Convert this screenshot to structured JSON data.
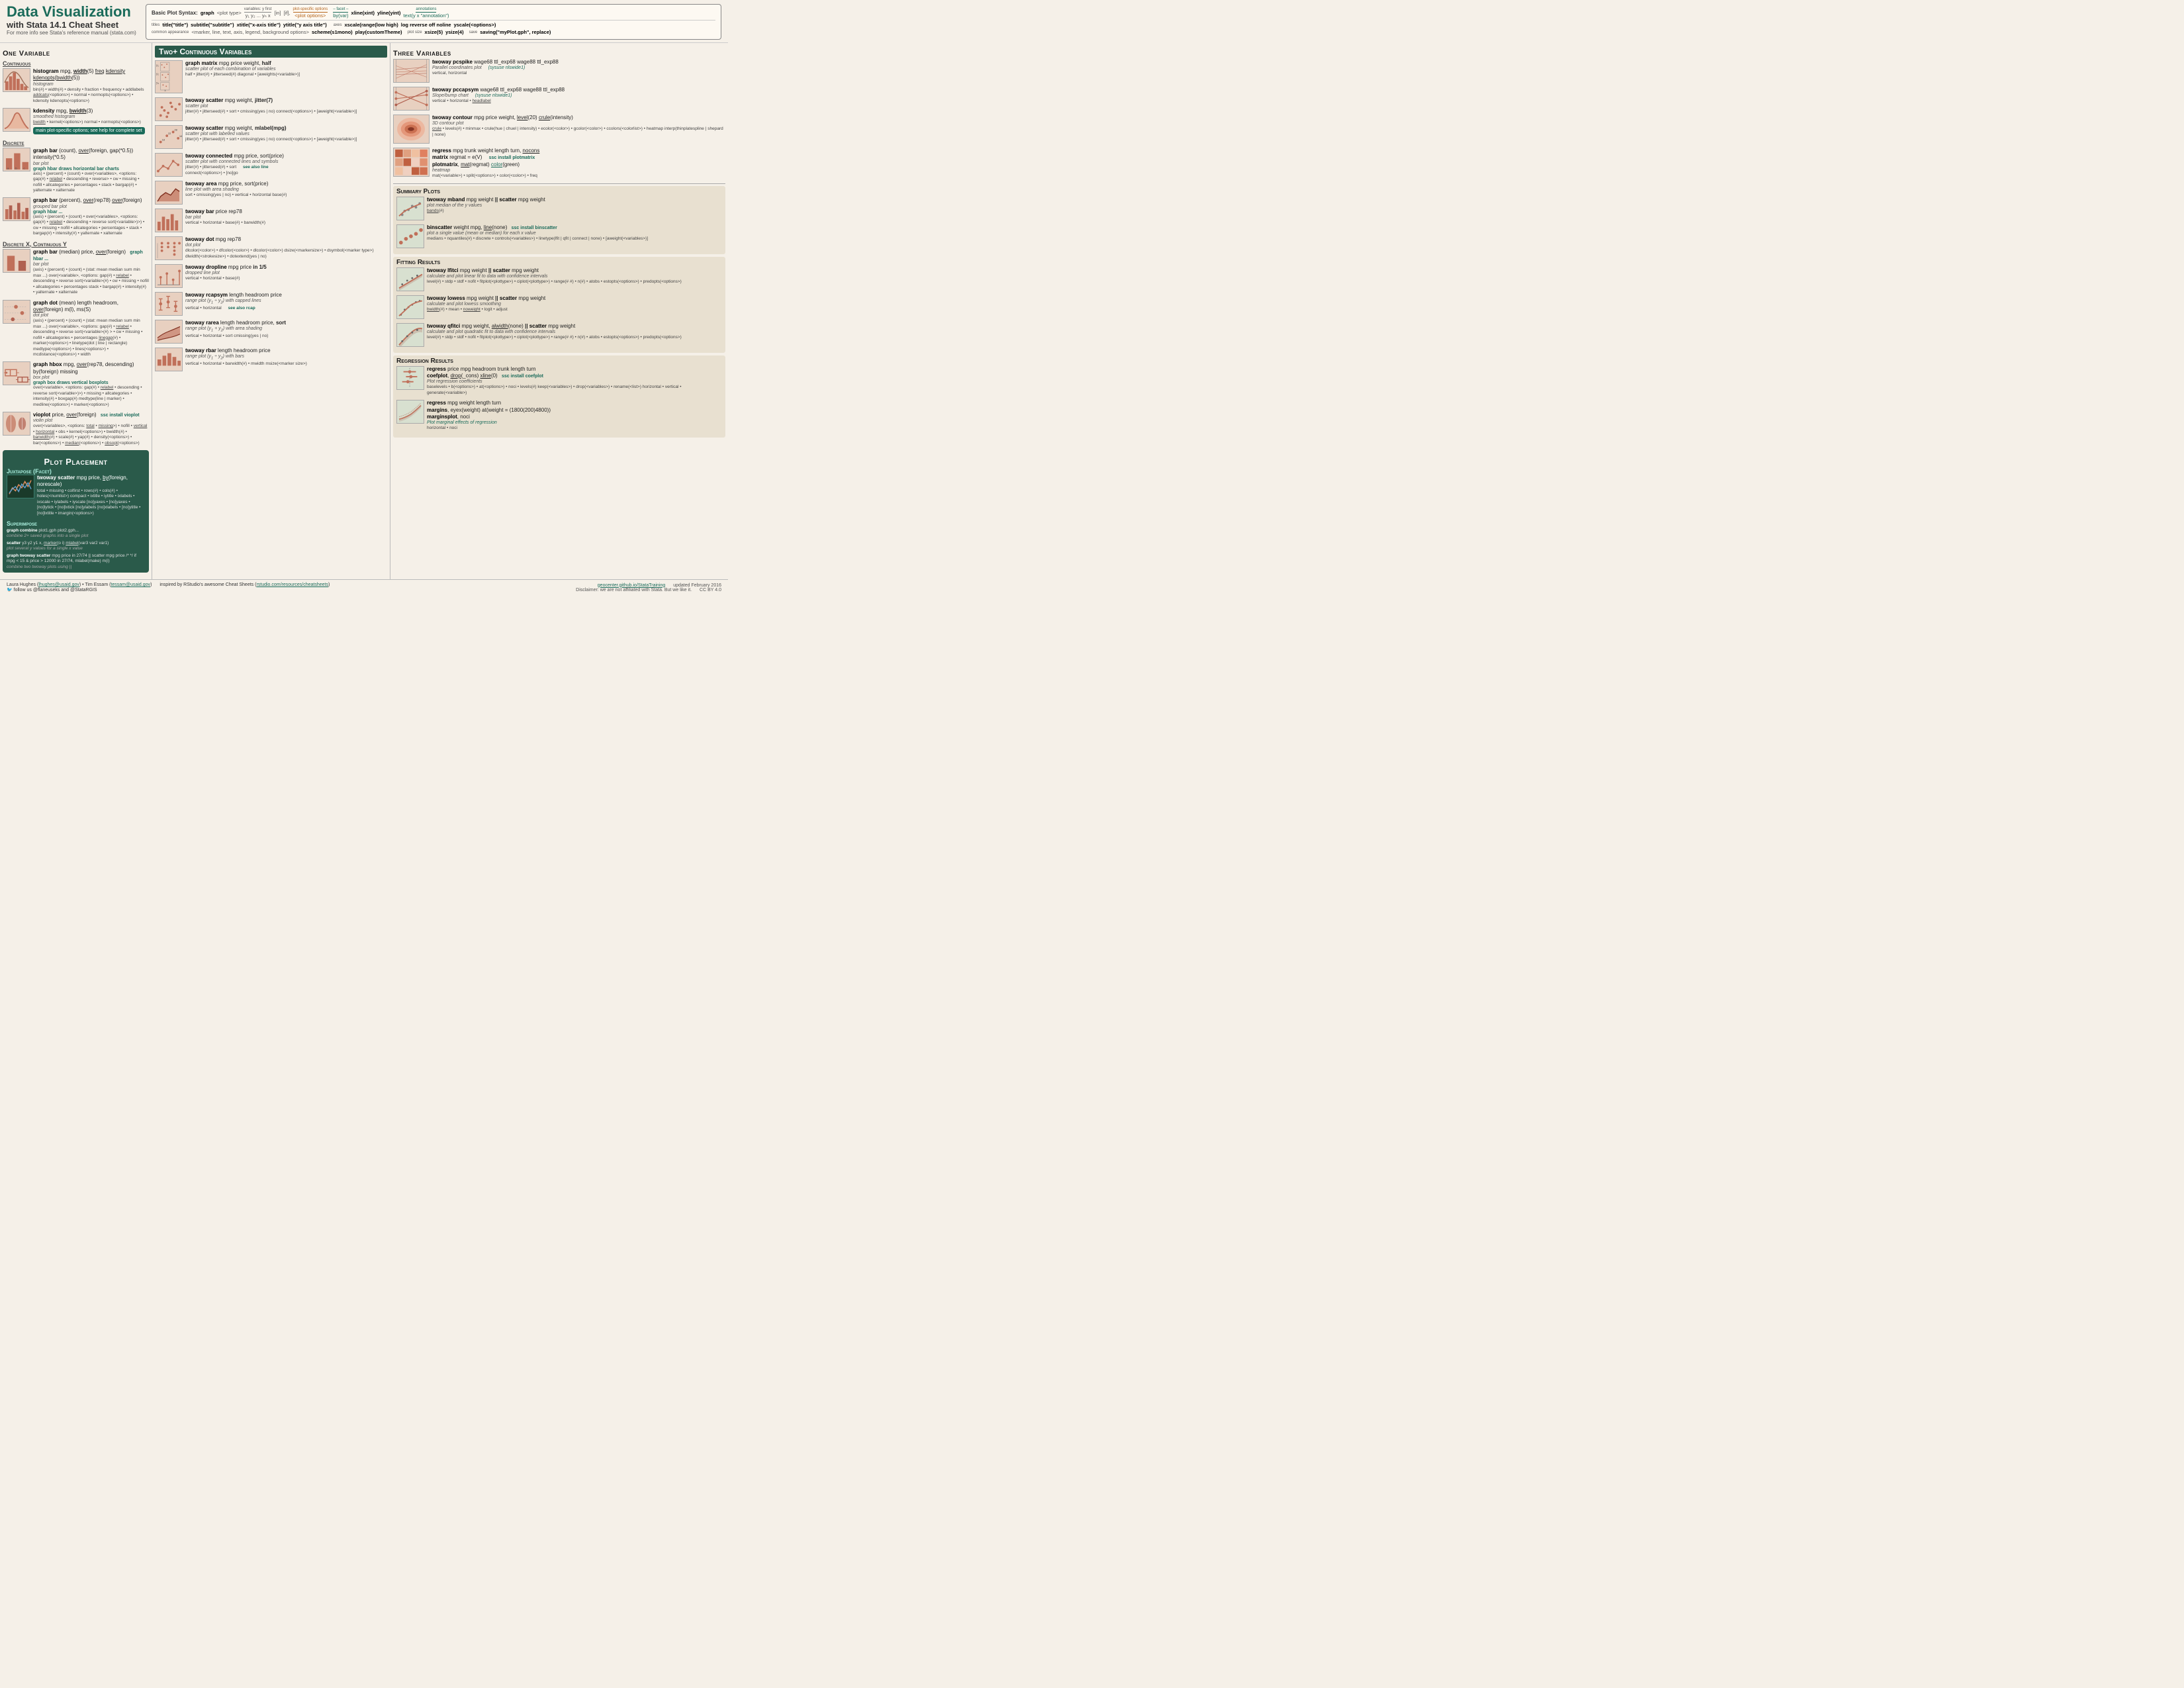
{
  "header": {
    "title": "Data Visualization",
    "subtitle": "with Stata 14.1   Cheat Sheet",
    "note": "For more info see Stata's reference manual (stata.com)",
    "syntax_label": "Basic Plot Syntax:",
    "syntax_graph": "graph",
    "syntax_plottype": "<plot type>",
    "syntax_vars_label": "variables: y first",
    "syntax_vars": "y₁ y₂ ... yₙ x",
    "syntax_in": "[in]",
    "syntax_if": "[if],",
    "syntax_plotopts_label": "plot-specific options",
    "syntax_plotopts": "<plot options>",
    "syntax_facet_label": "facet",
    "syntax_facet": "– facet –",
    "syntax_by": "by(var)",
    "syntax_xline": "xline(xint)",
    "syntax_yline": "yline(yint)",
    "syntax_ann_label": "annotations",
    "syntax_text": "text(y x \"annotation\")",
    "titles_label": "titles",
    "title_cmd": "title(\"title\")",
    "subtitle_cmd": "subtitle(\"subtitle\")",
    "xtitle_cmd": "xtitle(\"x-axis title\")",
    "ytitle_cmd": "ytitle(\"y axis title\")",
    "axes_label": "axes",
    "xscale_cmd": "xscale(range(low high)",
    "log_cmd": "log reverse off noline",
    "yscale_cmd": "yscale(<options>)",
    "common_appearance_label": "common appearance",
    "common_appearance": "<marker, line, text, axis, legend, background options>",
    "scheme_cmd": "scheme(s1mono)",
    "play_cmd": "play(customTheme)",
    "plot_size_label": "plot size",
    "xsize_cmd": "xsize(5)",
    "ysize_cmd": "ysize(4)",
    "save_label": "save",
    "saving_cmd": "saving(\"myPlot.gph\", replace)"
  },
  "one_variable": {
    "header": "One Variable",
    "continuous_header": "Continuous",
    "histogram_cmd": "histogram mpg, width(5) freq kdensity kdenopts(bwidth(5))",
    "histogram_sub": "histogram",
    "histogram_opts": "bin(#) • width(#) • density • fraction • frequency • addlabels addcats(<options>) • normal • normopts(<options>) • kdensity kdenopts(<options>)",
    "kdensity_cmd": "kdensity mpg, bwidth(3)",
    "kdensity_sub": "smoothed histogram",
    "kdensity_opts": "bwidth • kernel(<options>) normal • normopts(<options>)",
    "discrete_header": "Discrete",
    "graph_bar_cmd": "graph bar (count), over(foreign, gap(*0.5)) intensity(*0.5)",
    "graph_bar_sub": "bar plot",
    "graph_hbar_note": "graph hbar draws horizontal bar charts",
    "graph_bar_opts": "axis) • (percent) • (count) • over(<variables>, <options: gap(#) • relabel • descending • reverse> • cw • missing • nofill • allcategories • percentages • stack • bargap(#) • yalternate • xalternate",
    "graph_bar2_cmd": "graph bar (percent), over(rep78) over(foreign)",
    "graph_bar2_sub": "grouped bar plot",
    "graph_bar2_note": "graph hbar ...",
    "graph_bar2_opts": "(axis) • (percent) • (count) • over(<variables>, <options: gap(#) • relabel • descending • reverse sort(<variable>)>) • cw • missing • nofill • allcategories • percentages • stack • bargap(#) • intensity(#) • yalternate • xalternate",
    "graph_bar3_cmd": "graph bar (percent), over(rep78) over(foreign)",
    "discrete_x_cont_y": "Discrete X, Continuous Y",
    "graph_bar_med_cmd": "graph bar (median) price, over(foreign)",
    "graph_bar_med_note": "graph hbar ...",
    "graph_bar_med_sub": "bar plot",
    "graph_bar_med_opts": "(axis) • (percent) • (count) • (stat: mean median sum min max ...) over(<variable>, <options: gap(#) • relabel • descending • reverse sort(<variable>(#) • cw • missing • nofill • allcategories • percentages stack • bargap(#) • intensity(#) • yalternate • xalternate",
    "graph_dot_cmd": "graph dot (mean) length headroom, over(foreign) m(l), ms(S)",
    "graph_dot_sub": "dot plot",
    "graph_dot_opts": "(axis) • (percent) • (count) • (stat: mean median sum min max ...) over(<variable>, <options: gap(#) • relabel • descending • reverse sort(<variable>(#) > • cw • missing • nofill • allcategories • percentages linegap(#) • marker(<options>) • linetype(dot | line | rectangle) medtype(<options>) • lines(<options>) • mcdistance(<options>) • width",
    "graph_hbox_cmd": "graph hbox mpg, over(rep78, descending) by(foreign) missing",
    "graph_hbox_sub": "box plot",
    "graph_hbox_note": "graph box draws vertical boxplots",
    "graph_hbox_opts": "over(<variable>, <options: gap(#) • relabel • descending • reverse sort(<variable>)>) • missing • allcategories • intensity(#) • boxgap(#) medtype(line | marker) • medline(<options>) • marker(<options>)",
    "vioplot_cmd": "vioplot price, over(foreign)",
    "vioplot_sub": "violin plot",
    "vioplot_note": "ssc install vioplot",
    "vioplot_opts": "over(<variables>, <options: total • missing>) • nofill • vertical • horizontal • obs • kernel(<options>) • bwidth(#) • barwidth(#) • scale(#) • yap(#) • density(<options>) • bar(<options>) • median(<options>) • obsopt(<options>)"
  },
  "plot_placement": {
    "header": "Plot Placement",
    "juxtapose_header": "Juxtapose (Facet)",
    "twoway_scatter_cmd": "twoway scatter mpg price, by(foreign, norescale)",
    "twoway_scatter_opts": "total • missing • colfirst • rows(#) • cols(#) • holes(<numlist>) compact • ixtitle • iytitle • ixlabels • ixscale • iylabels • iyscale [no]yaxes • [no]yaxes • [no]lytick • [no]lxtick [no]ylabels [no]xlabels • [no]ytitle • [no]lxtitle • imargin(<options>)",
    "superimpose_header": "Superimpose",
    "graph_combine_cmd": "graph combine plot1.gph plot2.gph...",
    "graph_combine_sub": "combine 2+ saved graphs into a single plot",
    "scatter_multi_cmd": "scatter y3 y2 y1 x, marker(o i) mlabel(var3 var2 var1)",
    "scatter_multi_sub": "plot several y values for a single x value",
    "twoway_scatter_if_cmd": "graph twoway scatter mpg price in 27/74 || scatter mpg price /* */ if mpg < 15 & price > 12000 in 27/74, mlabel(make) m(i)",
    "twoway_scatter_if_sub": "combine two twoway plots using ||"
  },
  "two_plus": {
    "header": "Two+ Continuous Variables",
    "graph_matrix_cmd": "graph matrix mpg price weight, half",
    "graph_matrix_sub": "scatter plot of each combination of variables",
    "graph_matrix_opts": "half • jitter(#) • jitterseed(#) diagonal • [aweights(<variable>)]",
    "twoway_scatter_cmd": "twoway scatter mpg weight, jitter(7)",
    "twoway_scatter_sub": "scatter plot",
    "twoway_scatter_opts": "jitter(#) • jitterseed(#) • sort • cmissing(yes | no) connect(<options>) • [aweight(<variable>)]",
    "twoway_scatter_ml_cmd": "twoway scatter mpg weight, mlabel(mpg)",
    "twoway_scatter_ml_sub": "scatter plot with labelled values",
    "twoway_scatter_ml_opts": "jitter(#) • jitterseed(#) • sort • cmissing(yes | no) connect(<options>) • [aweight(<variable>)]",
    "twoway_connected_cmd": "twoway connected mpg price, sort(price)",
    "twoway_connected_sub": "scatter plot with connected lines and symbols",
    "twoway_connected_note": "see also line",
    "twoway_connected_opts": "jitter(#) • jitterseed(#) • sort connect(<options>) • [no]go",
    "twoway_area_cmd": "twoway area mpg price, sort(price)",
    "twoway_area_sub": "line plot with area shading",
    "twoway_area_opts": "sort • cmissing(yes | no) • vertical • horizontal base(#)",
    "twoway_bar_cmd": "twoway bar price rep78",
    "twoway_bar_sub": "bar plot",
    "twoway_bar_opts": "vertical • horizontal • base(#) • barwidth(#)",
    "twoway_dot_cmd": "twoway dot mpg rep78",
    "twoway_dot_sub": "dot plot",
    "twoway_dot_opts": "dlcolor(<color>) • dfcolor(<color>) • dlcolor(<color>) dsize(<markersize>) • dsymbol(<marker type>) dlwidth(<strokesize>) • dotextendyes | no",
    "twoway_dropline_cmd": "twoway dropline mpg price in 1/5",
    "twoway_dropline_sub": "dropped line plot",
    "twoway_dropline_opts": "vertical • horizontal • base(#)",
    "twoway_rcapsym_cmd": "twoway rcapsym length headroom price",
    "twoway_rcapsym_sub": "range plot (y₁ ÷ y₂) with capped lines",
    "twoway_rcapsym_note": "see also rcap",
    "twoway_rcapsym_opts": "vertical • horizontal",
    "twoway_rarea_cmd": "twoway rarea length headroom price, sort",
    "twoway_rarea_sub": "range plot (y₁ + y₂) with area shading",
    "twoway_rarea_opts": "vertical • horizontal • sort cmissing(yes | no)",
    "twoway_rbar_cmd": "twoway rbar length headroom price",
    "twoway_rbar_sub": "range plot (y₁ ÷ y₂) with bars",
    "twoway_rbar_opts": "vertical • horizontal • barwidth(#) • mwidth msize(<marker size>)"
  },
  "three_variables": {
    "header": "Three Variables",
    "twoway_pcspike_cmd": "twoway pcspike wage68 ttl_exp68 wage88 ttl_exp88",
    "twoway_pcspike_sub": "Parallel coordinates plot",
    "twoway_pcspike_note": "(sysuse nlswide1)",
    "twoway_pcspike_opts": "vertical, horizontal",
    "twoway_pccapsym_cmd": "twoway pccapsym wage68 ttl_exp68 wage88 ttl_exp88",
    "twoway_pccapsym_sub": "Slope/bump chart",
    "twoway_pccapsym_note": "(sysuse nlswide1)",
    "twoway_pccapsym_opts": "vertical • horizontal • headlabel",
    "twoway_contour_cmd": "twoway contour mpg price weight, level(20) crule(intensity)",
    "twoway_contour_sub": "3D contour plot",
    "twoway_contour_opts": "crule • levels(#) • minmax • crule(hue | chuel | intensity) • ecolor(<color>) • gcolor(<color>) • ccolors(<colorlist>) • heatmap interp(thinplatespline | shepard | none)",
    "regress_plotmatrix_cmd": "regress mpg trunk weight length turn, nocons matrix regmat = e(V)",
    "regress_plotmatrix_sub": "ssc install plotmatrix",
    "plotmatrix_cmd": "plotmatrix, mat(regmat) color(green)",
    "plotmatrix_sub": "heatmap",
    "plotmatrix_opts": "mat(<variable>) • split(<options>) • color(<color>) • freq"
  },
  "summary_plots": {
    "header": "Summary Plots",
    "twoway_mband_cmd": "twoway mband mpg weight || scatter mpg weight",
    "twoway_mband_sub": "plot median of the y values",
    "twoway_mband_opts": "bands(#)",
    "binscatter_cmd": "binscatter weight mpg, line(none)",
    "binscatter_note": "ssc install binscatter",
    "binscatter_sub": "plot a single value (mean or median) for each x value",
    "binscatter_opts": "medians • nquantiles(#) • discrete • controls(<variables>) • linetype(lfit | qfit | connect | none) • [aweight(<variables>)]",
    "fitting_header": "Fitting Results",
    "twoway_lfitci_cmd": "twoway lfitci mpg weight || scatter mpg weight",
    "twoway_lfitci_sub": "calculate and plot linear fit to data with confidence intervals",
    "twoway_lfitci_opts": "level(#) • stdp • stdf • nofit • fitplot(<plottype>) • ciplot(<plottype>) • range(# #) • n(#) • atobs • estopts(<options>) • predopts(<options>)",
    "twoway_lowess_cmd": "twoway lowess mpg weight || scatter mpg weight",
    "twoway_lowess_sub": "calculate and plot lowess smoothing",
    "twoway_lowess_opts": "bwidth(#) • mean • noweight • logit • adjust",
    "twoway_qfitci_cmd": "twoway qfitci mpg weight, alwidth(none) || scatter mpg weight",
    "twoway_qfitci_sub": "calculate and plot quadratic fit to data with confidence intervals",
    "twoway_qfitci_opts": "level(#) • stdp • stdf • nofit • fitplot(<plottype>) • ciplot(<plottype>) • range(# #) • n(#) • atobs • estopts(<options>) • predopts(<options>)",
    "regression_header": "Regression Results",
    "regress_cmd": "regress price mpg headroom trunk length turn",
    "coefplot_cmd": "coefplot, drop(_cons) xline(0)",
    "coefplot_note": "ssc install coefplot",
    "coefplot_sub": "Plot regression coefficients",
    "coefplot_opts": "baselevels • b(<options>) • at(<options>) • noci • levels(#) keep(<variables>) • drop(<variables>) • rename(<list>) horizontal • vertical • generate(<variable>)",
    "regress2_cmd": "regress mpg weight length turn",
    "margins_cmd": "margins, eyex(weight) at(weight = (1800(200)4800))",
    "marginsplot_cmd": "marginsplot, noci",
    "marginsplot_sub": "Plot marginal effects of regression",
    "marginsplot_opts": "horizontal • noci"
  },
  "footer": {
    "author1": "Laura Hughes (lhughes@usaid.gov)",
    "author2": "Tim Essam (tessam@usaid.gov)",
    "inspired": "inspired by RStudio's awesome Cheat Sheets (rstudio.com/resources/cheatsheets)",
    "github": "geocenter.github.io/StataTraining",
    "updated": "updated February 2016",
    "disclaimer": "Disclaimer: we are not affiliated with Stata. But we like it.",
    "twitter": "follow us @flaneuseks and @StataRGIS",
    "license": "CC BY 4.0"
  }
}
